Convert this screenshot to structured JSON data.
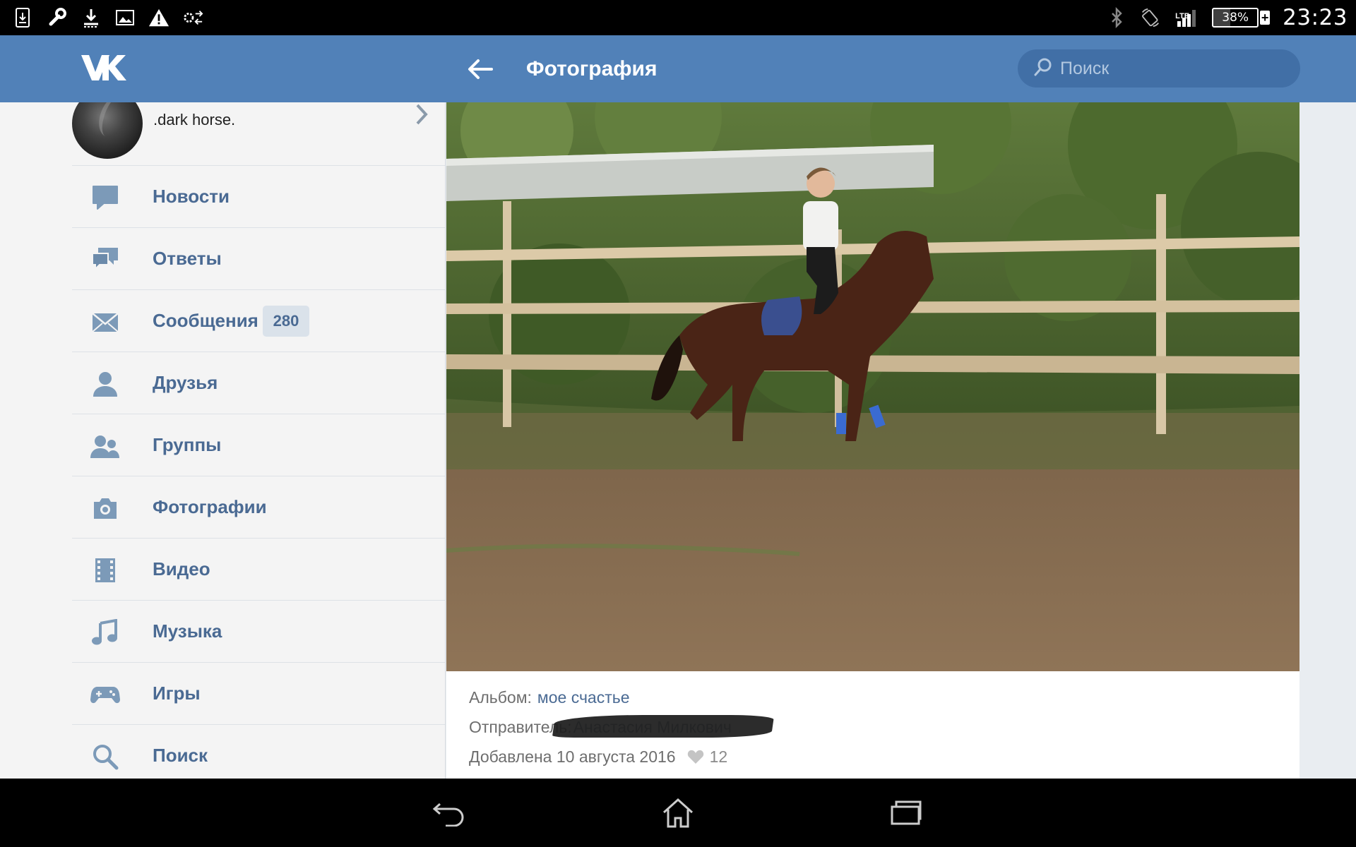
{
  "status_bar": {
    "time": "23:23",
    "battery_percent": "38%",
    "network": "LTE",
    "left_icons": [
      "sim-download-icon",
      "wrench-icon",
      "download-icon",
      "image-icon",
      "warning-icon",
      "sync-settings-icon"
    ],
    "right_icons": [
      "bluetooth-icon",
      "screen-rotation-icon",
      "signal-icon",
      "battery-icon"
    ]
  },
  "header": {
    "logo": "VK",
    "title": "Фотография",
    "search_placeholder": "Поиск"
  },
  "sidebar": {
    "profile_name": ".dark horse.",
    "items": [
      {
        "label": "Новости",
        "icon": "news-bubble-icon"
      },
      {
        "label": "Ответы",
        "icon": "replies-bubbles-icon"
      },
      {
        "label": "Сообщения",
        "icon": "envelope-icon",
        "badge": "280"
      },
      {
        "label": "Друзья",
        "icon": "person-icon"
      },
      {
        "label": "Группы",
        "icon": "group-icon"
      },
      {
        "label": "Фотографии",
        "icon": "camera-icon"
      },
      {
        "label": "Видео",
        "icon": "film-icon"
      },
      {
        "label": "Музыка",
        "icon": "music-note-icon"
      },
      {
        "label": "Игры",
        "icon": "gamepad-icon"
      },
      {
        "label": "Поиск",
        "icon": "search-icon"
      }
    ]
  },
  "photo_info": {
    "album_label": "Альбом:",
    "album_name": "мое счастье",
    "sender_label": "Отправитель:",
    "sender_name": "Анастасия Милкович",
    "added": "Добавлена 10 августа 2016",
    "likes": "12"
  },
  "colors": {
    "header": "#5181b8",
    "search": "#416fa6",
    "menu_text": "#4a6a93",
    "sidebar_bg": "#f4f4f4"
  }
}
